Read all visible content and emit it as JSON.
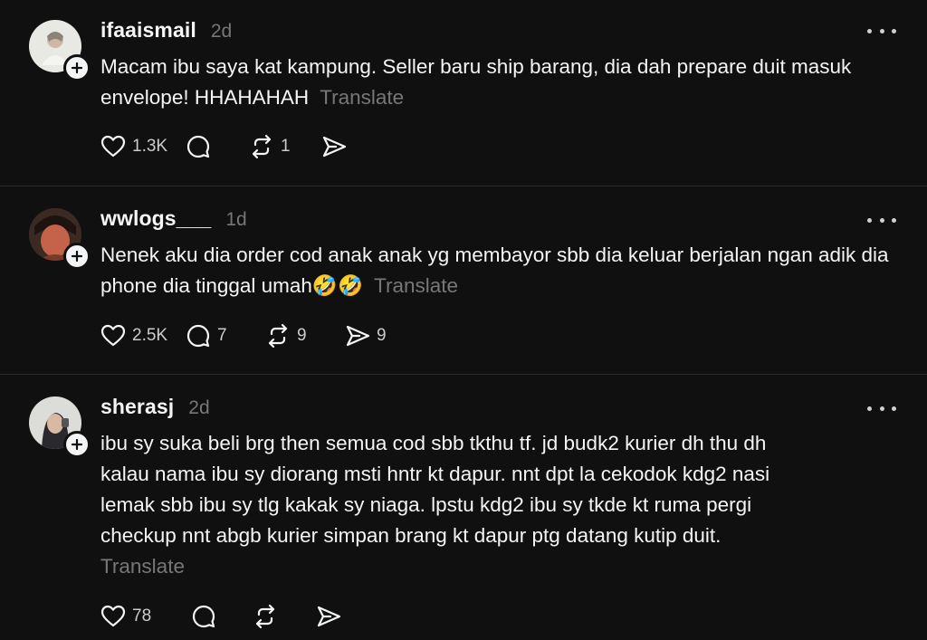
{
  "posts": [
    {
      "username": "ifaaismail",
      "time": "2d",
      "text": "Macam ibu saya kat kampung. Seller baru ship barang, dia dah prepare duit masuk envelope! HHAHAHAH",
      "translate_label": "Translate",
      "likes": "1.3K",
      "replies": "",
      "reposts": "1",
      "shares": ""
    },
    {
      "username": "wwlogs___",
      "time": "1d",
      "text": "Nenek aku dia order cod anak anak yg membayor sbb dia keluar berjalan ngan adik dia phone dia tinggal umah🤣🤣",
      "translate_label": "Translate",
      "likes": "2.5K",
      "replies": "7",
      "reposts": "9",
      "shares": "9"
    },
    {
      "username": "sherasj",
      "time": "2d",
      "text": "ibu sy suka beli brg then semua cod sbb tkthu tf. jd budk2 kurier dh thu dh kalau nama ibu sy diorang msti hntr kt dapur. nnt dpt la cekodok kdg2 nasi lemak sbb ibu sy tlg kakak sy niaga. lpstu kdg2 ibu sy tkde kt ruma pergi checkup nnt abgb kurier simpan brang kt dapur ptg datang kutip duit.",
      "translate_label": "Translate",
      "likes": "78",
      "replies": "",
      "reposts": "",
      "shares": ""
    }
  ],
  "icons": {
    "like": "heart-icon",
    "reply": "comment-icon",
    "repost": "repost-icon",
    "share": "share-icon",
    "more": "more-horizontal-icon",
    "follow": "plus-icon"
  },
  "colors": {
    "background": "#101010",
    "text": "#f3f5f7",
    "muted": "#777777",
    "divider": "#2c2c2c"
  }
}
